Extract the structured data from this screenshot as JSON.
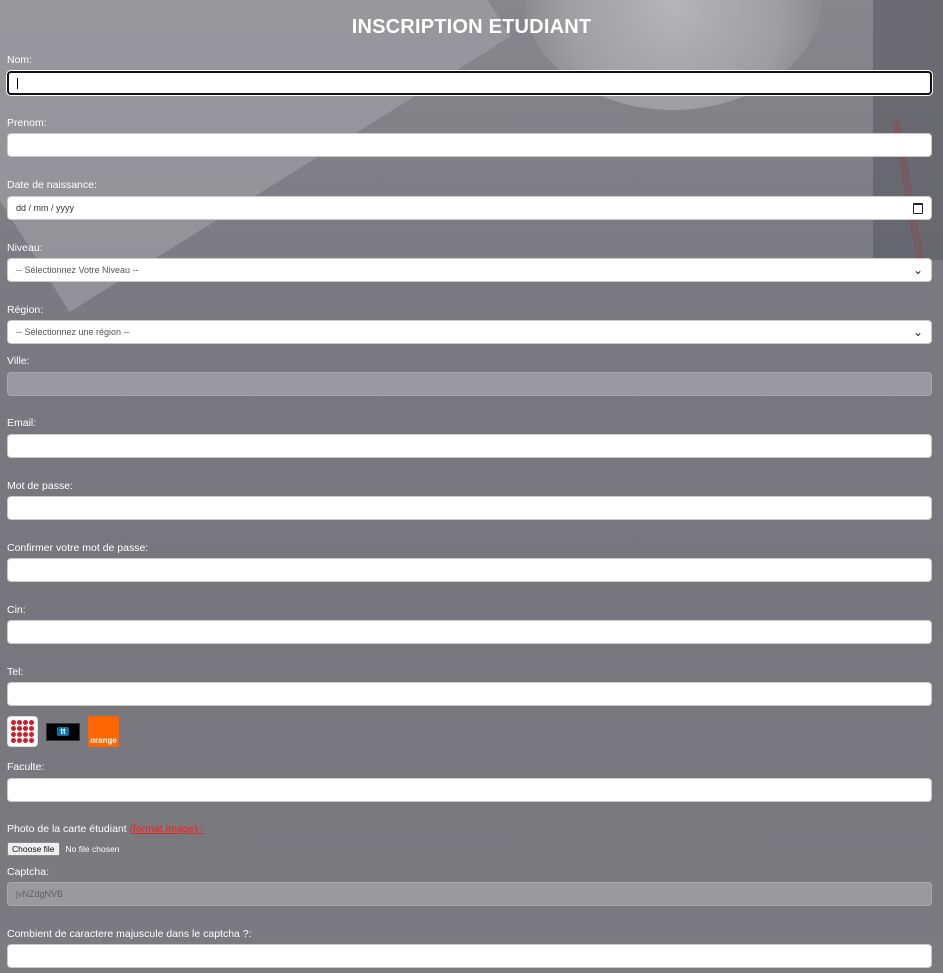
{
  "form": {
    "title": "INSCRIPTION ETUDIANT",
    "nom_label": "Nom:",
    "prenom_label": "Prenom:",
    "naissance_label": "Date de naissance:",
    "naissance_placeholder": "dd / mm / yyyy",
    "niveau_label": "Niveau:",
    "niveau_value": "-- Sélectionnez Votre Niveau --",
    "region_label": "Région:",
    "region_value": "-- Sélectionnez une région --",
    "ville_label": "Ville:",
    "email_label": "Email:",
    "mdp_label": "Mot de passe:",
    "confirm_label": "Confirmer votre mot de passe:",
    "cin_label": "Cin:",
    "tel_label": "Tel:",
    "operators": [
      "ooredoo",
      "tt",
      "orange"
    ],
    "orange_text": "orange",
    "tt_text": "tt",
    "faculte_label": "Faculte:",
    "photo_label": "Photo de la carte étudiant",
    "photo_format": "(format image) :",
    "file_button": "Choose file",
    "file_status": "No file chosen",
    "captcha_label": "Captcha:",
    "captcha_value": "jvNZdgNVB",
    "question_label": "Combient de caractere majuscule dans le captcha ?:"
  },
  "colors": {
    "background": "#77777d",
    "label": "#ffffff",
    "format_link": "#ff1a1a",
    "disabled_field": "#9a9a9e"
  }
}
